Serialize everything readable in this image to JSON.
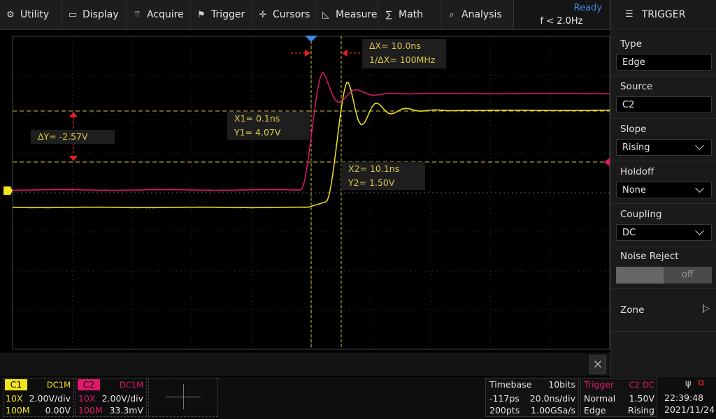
{
  "menu": {
    "utility": "Utility",
    "display": "Display",
    "acquire": "Acquire",
    "trigger": "Trigger",
    "cursors": "Cursors",
    "measure": "Measure",
    "math": "Math",
    "analysis": "Analysis"
  },
  "status": {
    "state": "Ready",
    "frequency": "f < 2.0Hz"
  },
  "panel": {
    "title": "TRIGGER",
    "type_label": "Type",
    "type_value": "Edge",
    "source_label": "Source",
    "source_value": "C2",
    "slope_label": "Slope",
    "slope_value": "Rising",
    "holdoff_label": "Holdoff",
    "holdoff_value": "None",
    "coupling_label": "Coupling",
    "coupling_value": "DC",
    "noise_label": "Noise Reject",
    "noise_value": "off",
    "zone_label": "Zone"
  },
  "cursors": {
    "dx": "ΔX= 10.0ns",
    "inv_dx": "1/ΔX= 100MHz",
    "dy": "ΔY= -2.57V",
    "x1": "X1= 0.1ns",
    "y1": "Y1= 4.07V",
    "x2": "X2= 10.1ns",
    "y2": "Y2= 1.50V"
  },
  "channels": {
    "c1": {
      "name": "C1",
      "coupling": "DC1M",
      "probe": "10X",
      "scale": "2.00V/div",
      "bandwidth": "100M",
      "offset": "0.00V",
      "color": "#f2e41c"
    },
    "c2": {
      "name": "C2",
      "coupling": "DC1M",
      "probe": "10X",
      "scale": "2.00V/div",
      "bandwidth": "100M",
      "offset": "33.3mV",
      "color": "#e0186c"
    }
  },
  "timebase": {
    "label": "Timebase",
    "bits": "10bits",
    "delay": "-117ps",
    "scale": "20.0ns/div",
    "points": "200pts",
    "rate": "1.00GSa/s"
  },
  "trigger_info": {
    "label": "Trigger",
    "source": "C2",
    "coupling": "DC",
    "mode": "Normal",
    "level": "1.50V",
    "type": "Edge",
    "slope": "Rising"
  },
  "clock": {
    "time": "22:39:48",
    "date": "2021/11/24"
  },
  "colors": {
    "accent_blue": "#3a8ee6",
    "c1_yellow": "#f2e41c",
    "c2_magenta": "#e0186c",
    "cursor_red": "#e52020"
  },
  "icons": [
    "gear-icon",
    "display-icon",
    "acquire-icon",
    "flag-icon",
    "crosshair-icon",
    "measure-icon",
    "sigma-icon",
    "analysis-icon",
    "list-icon",
    "usb-icon",
    "network-icon",
    "close-icon"
  ]
}
